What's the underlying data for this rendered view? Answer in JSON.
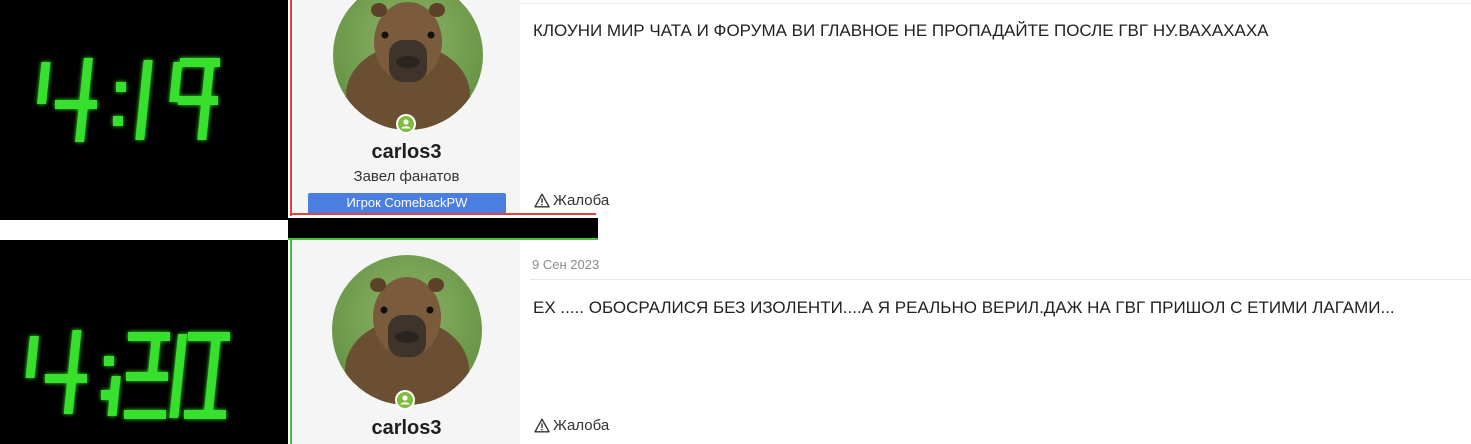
{
  "clocks": {
    "first": "4:19",
    "second": "4:20",
    "digit_color": "#39e02f"
  },
  "posts": [
    {
      "author": "carlos3",
      "user_title": "Завел фанатов",
      "user_badge": "Игрок ComebackPW",
      "text": "КЛОУНИ МИР ЧАТА И ФОРУМА ВИ ГЛАВНОЕ НЕ ПРОПАДАЙТЕ ПОСЛЕ ГВГ НУ.ВАХАХАХА",
      "report_label": "Жалоба"
    },
    {
      "date": "9 Сен 2023",
      "author": "carlos3",
      "text": "ЕХ ..... ОБОСРАЛИСЯ БЕЗ ИЗОЛЕНТИ....А Я РЕАЛЬНО ВЕРИЛ.ДАЖ НА ГВГ ПРИШОЛ С ЕТИМИ ЛАГАМИ...",
      "report_label": "Жалоба"
    }
  ],
  "colors": {
    "badge": "#4a7ee0",
    "online": "#7cbd3b",
    "highlight_red": "#e34040",
    "highlight_green": "#42c33a"
  },
  "icons": {
    "online": "user-online-icon",
    "report": "warning-triangle-icon",
    "avatar": "capybara-avatar"
  }
}
